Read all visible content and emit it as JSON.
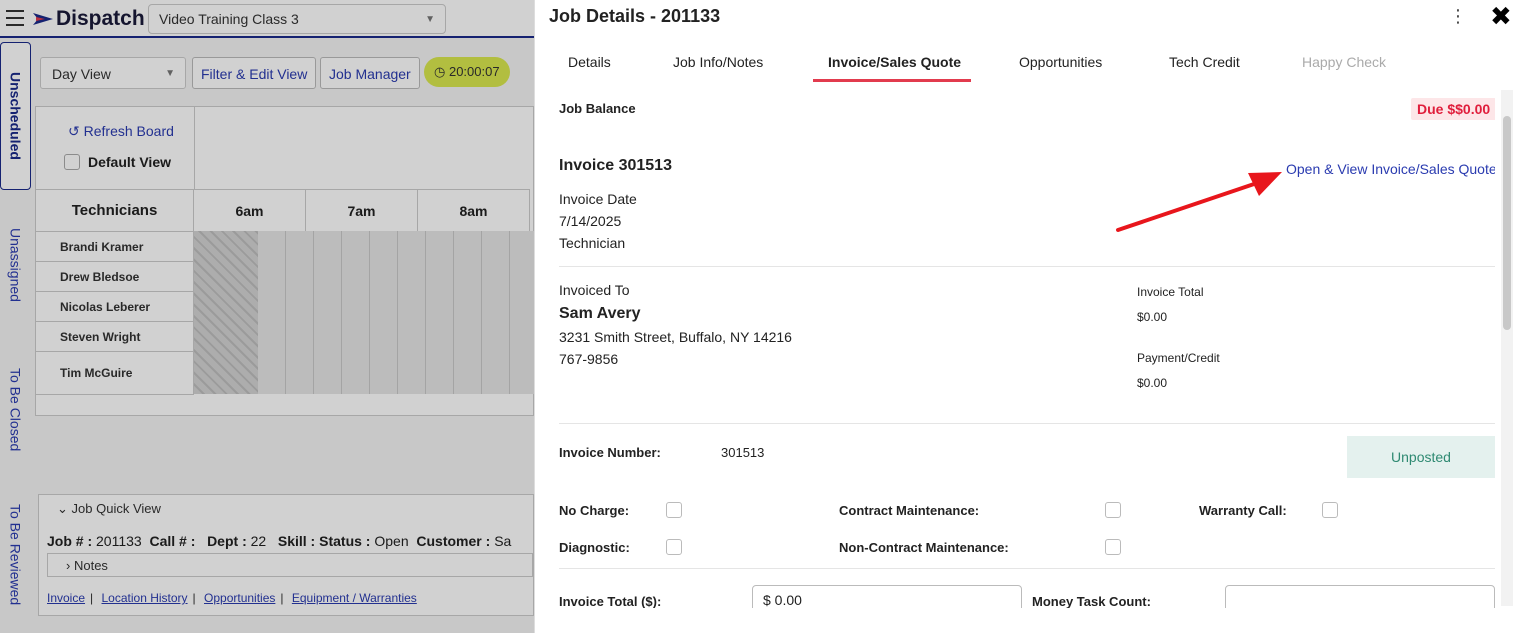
{
  "app": {
    "name": "Dispatch",
    "company": "Video Training Class 3",
    "side_tabs": [
      "Unscheduled",
      "Unassigned",
      "To Be Closed",
      "To Be Reviewed"
    ],
    "view_select": "Day View",
    "filter_btn": "Filter & Edit View",
    "job_manager_btn": "Job Manager",
    "timer": "20:00:07",
    "refresh": "Refresh Board",
    "default_view": "Default View",
    "technicians_header": "Technicians",
    "hours": [
      "6am",
      "7am",
      "8am"
    ],
    "technicians": [
      "Brandi Kramer",
      "Drew Bledsoe",
      "Nicolas Leberer",
      "Steven Wright",
      "Tim McGuire"
    ],
    "quick_view": {
      "title": "Job Quick View",
      "job_label": "Job # :",
      "job_value": "201133",
      "call_label": "Call # :",
      "dept_label": "Dept :",
      "dept_value": "22",
      "skill_label": "Skill :",
      "status_label": "Status :",
      "status_value": "Open",
      "customer_label": "Customer :",
      "customer_value": "Sa",
      "notes": "Notes",
      "links": [
        "Invoice",
        "Location History",
        "Opportunities",
        "Equipment / Warranties"
      ]
    }
  },
  "modal": {
    "title": "Job Details - 201133",
    "tabs": [
      "Details",
      "Job Info/Notes",
      "Invoice/Sales Quote",
      "Opportunities",
      "Tech Credit",
      "Happy Check"
    ],
    "active_tab": "Invoice/Sales Quote",
    "job_balance_label": "Job Balance",
    "due_badge": "Due $$0.00",
    "invoice_heading": "Invoice 301513",
    "open_link": "Open & View Invoice/Sales Quote",
    "invoice_date_label": "Invoice Date",
    "invoice_date": "7/14/2025",
    "technician_label": "Technician",
    "invoiced_to_label": "Invoiced To",
    "customer_name": "Sam Avery",
    "address": "3231 Smith Street, Buffalo, NY 14216",
    "phone": "767-9856",
    "invoice_total_label": "Invoice Total",
    "invoice_total": "$0.00",
    "payment_label": "Payment/Credit",
    "payment": "$0.00",
    "invoice_number_label": "Invoice Number:",
    "invoice_number": "301513",
    "posted_status": "Unposted",
    "checks": {
      "no_charge": "No Charge:",
      "diagnostic": "Diagnostic:",
      "contract": "Contract Maintenance:",
      "non_contract": "Non-Contract Maintenance:",
      "warranty": "Warranty Call:"
    },
    "invoice_total_field_label": "Invoice Total ($):",
    "invoice_total_field_value": "$ 0.00",
    "money_task_label": "Money Task Count:"
  },
  "colors": {
    "accent_red": "#e23b4e",
    "link_blue": "#2a3bb0",
    "unposted_green": "#2f8a72",
    "timer_yellow": "#d9e84f"
  }
}
